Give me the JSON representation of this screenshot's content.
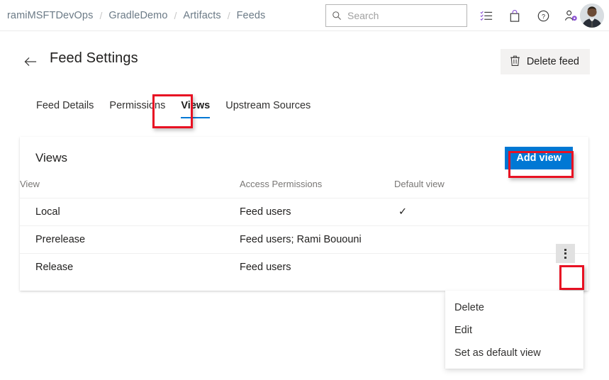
{
  "header": {
    "breadcrumb": [
      {
        "label": "ramiMSFTDevOps"
      },
      {
        "label": "GradleDemo"
      },
      {
        "label": "Artifacts"
      },
      {
        "label": "Feeds"
      }
    ],
    "separator": "/",
    "search": {
      "placeholder": "Search",
      "value": "",
      "icon": "search-icon"
    },
    "icons": [
      {
        "name": "boards-checklist-icon"
      },
      {
        "name": "marketplace-bag-icon"
      },
      {
        "name": "help-question-icon"
      },
      {
        "name": "user-settings-icon"
      }
    ],
    "avatar": {
      "name": "user-avatar"
    }
  },
  "titlebar": {
    "back_icon": "back-arrow-icon",
    "title": "Feed Settings",
    "delete_feed": {
      "label": "Delete feed",
      "icon": "trash-icon"
    }
  },
  "tabs": [
    {
      "label": "Feed Details",
      "active": false
    },
    {
      "label": "Permissions",
      "active": false
    },
    {
      "label": "Views",
      "active": true
    },
    {
      "label": "Upstream Sources",
      "active": false
    }
  ],
  "card": {
    "title": "Views",
    "add_button": "Add view",
    "columns": {
      "view": "View",
      "permissions": "Access Permissions",
      "default": "Default view"
    },
    "rows": [
      {
        "view": "Local",
        "permissions": "Feed users",
        "default": "✓",
        "kebab": ""
      },
      {
        "view": "Prerelease",
        "permissions": "Feed users; Rami Bououni",
        "default": "",
        "kebab": ""
      },
      {
        "view": "Release",
        "permissions": "Feed users",
        "default": "",
        "kebab": ""
      }
    ]
  },
  "context_menu": {
    "items": [
      {
        "label": "Delete"
      },
      {
        "label": "Edit"
      },
      {
        "label": "Set as default view"
      }
    ]
  },
  "annotations": {
    "color": "#e81123",
    "targets": [
      "views-tab",
      "add-view-button",
      "row-kebab-button"
    ]
  },
  "colors": {
    "accent": "#0078d4",
    "annotation": "#e81123",
    "button_bg": "#f3f2f1",
    "text": "#201f1e",
    "muted": "#797775"
  }
}
